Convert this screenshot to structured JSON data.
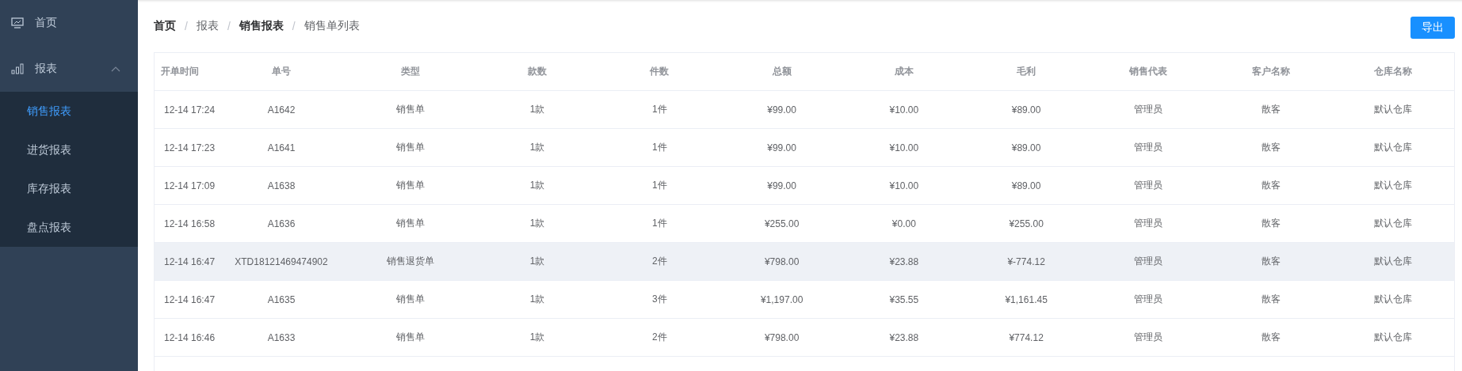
{
  "sidebar": {
    "items": [
      {
        "label": "首页"
      },
      {
        "label": "报表",
        "expanded": true,
        "children": [
          {
            "label": "销售报表",
            "selected": true
          },
          {
            "label": "进货报表",
            "selected": false
          },
          {
            "label": "库存报表",
            "selected": false
          },
          {
            "label": "盘点报表",
            "selected": false
          }
        ]
      }
    ]
  },
  "breadcrumb": [
    {
      "kind": "link",
      "label": "首页"
    },
    {
      "kind": "separator",
      "label": "/"
    },
    {
      "kind": "text",
      "label": "报表"
    },
    {
      "kind": "separator",
      "label": "/"
    },
    {
      "kind": "link",
      "label": "销售报表"
    },
    {
      "kind": "separator",
      "label": "/"
    },
    {
      "kind": "text",
      "label": "销售单列表"
    }
  ],
  "export_button": "导出",
  "table": {
    "columns": [
      "开单时间",
      "单号",
      "类型",
      "款数",
      "件数",
      "总额",
      "成本",
      "毛利",
      "销售代表",
      "客户名称",
      "仓库名称"
    ],
    "rows": [
      {
        "highlighted": false,
        "cells": [
          "12-14 17:24",
          "A1642",
          "销售单",
          "1款",
          "1件",
          "¥99.00",
          "¥10.00",
          "¥89.00",
          "管理员",
          "散客",
          "默认仓库"
        ]
      },
      {
        "highlighted": false,
        "cells": [
          "12-14 17:23",
          "A1641",
          "销售单",
          "1款",
          "1件",
          "¥99.00",
          "¥10.00",
          "¥89.00",
          "管理员",
          "散客",
          "默认仓库"
        ]
      },
      {
        "highlighted": false,
        "cells": [
          "12-14 17:09",
          "A1638",
          "销售单",
          "1款",
          "1件",
          "¥99.00",
          "¥10.00",
          "¥89.00",
          "管理员",
          "散客",
          "默认仓库"
        ]
      },
      {
        "highlighted": false,
        "cells": [
          "12-14 16:58",
          "A1636",
          "销售单",
          "1款",
          "1件",
          "¥255.00",
          "¥0.00",
          "¥255.00",
          "管理员",
          "散客",
          "默认仓库"
        ]
      },
      {
        "highlighted": true,
        "cells": [
          "12-14 16:47",
          "XTD18121469474902",
          "销售退货单",
          "1款",
          "2件",
          "¥798.00",
          "¥23.88",
          "¥-774.12",
          "管理员",
          "散客",
          "默认仓库"
        ]
      },
      {
        "highlighted": false,
        "cells": [
          "12-14 16:47",
          "A1635",
          "销售单",
          "1款",
          "3件",
          "¥1,197.00",
          "¥35.55",
          "¥1,161.45",
          "管理员",
          "散客",
          "默认仓库"
        ]
      },
      {
        "highlighted": false,
        "cells": [
          "12-14 16:46",
          "A1633",
          "销售单",
          "1款",
          "2件",
          "¥798.00",
          "¥23.88",
          "¥774.12",
          "管理员",
          "散客",
          "默认仓库"
        ]
      }
    ]
  }
}
